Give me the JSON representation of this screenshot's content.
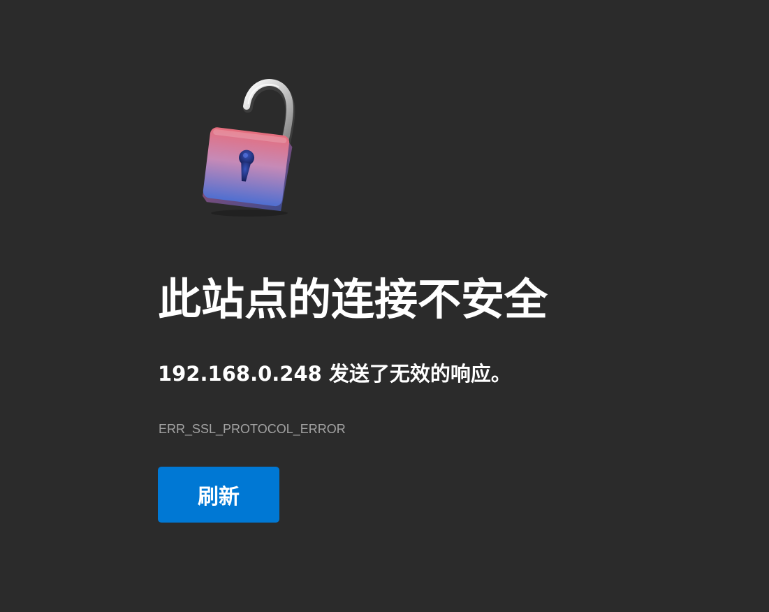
{
  "page": {
    "title": "此站点的连接不安全",
    "subtitle": "192.168.0.248 发送了无效的响应。",
    "error_code": "ERR_SSL_PROTOCOL_ERROR",
    "refresh_label": "刷新"
  },
  "icons": {
    "hero": "unlocked-padlock-icon"
  },
  "colors": {
    "background": "#2b2b2b",
    "primary": "#0078d4",
    "text": "#ffffff",
    "muted": "#a3a3a3",
    "lock_top": "#e06b82",
    "lock_bottom": "#5a74d0"
  }
}
